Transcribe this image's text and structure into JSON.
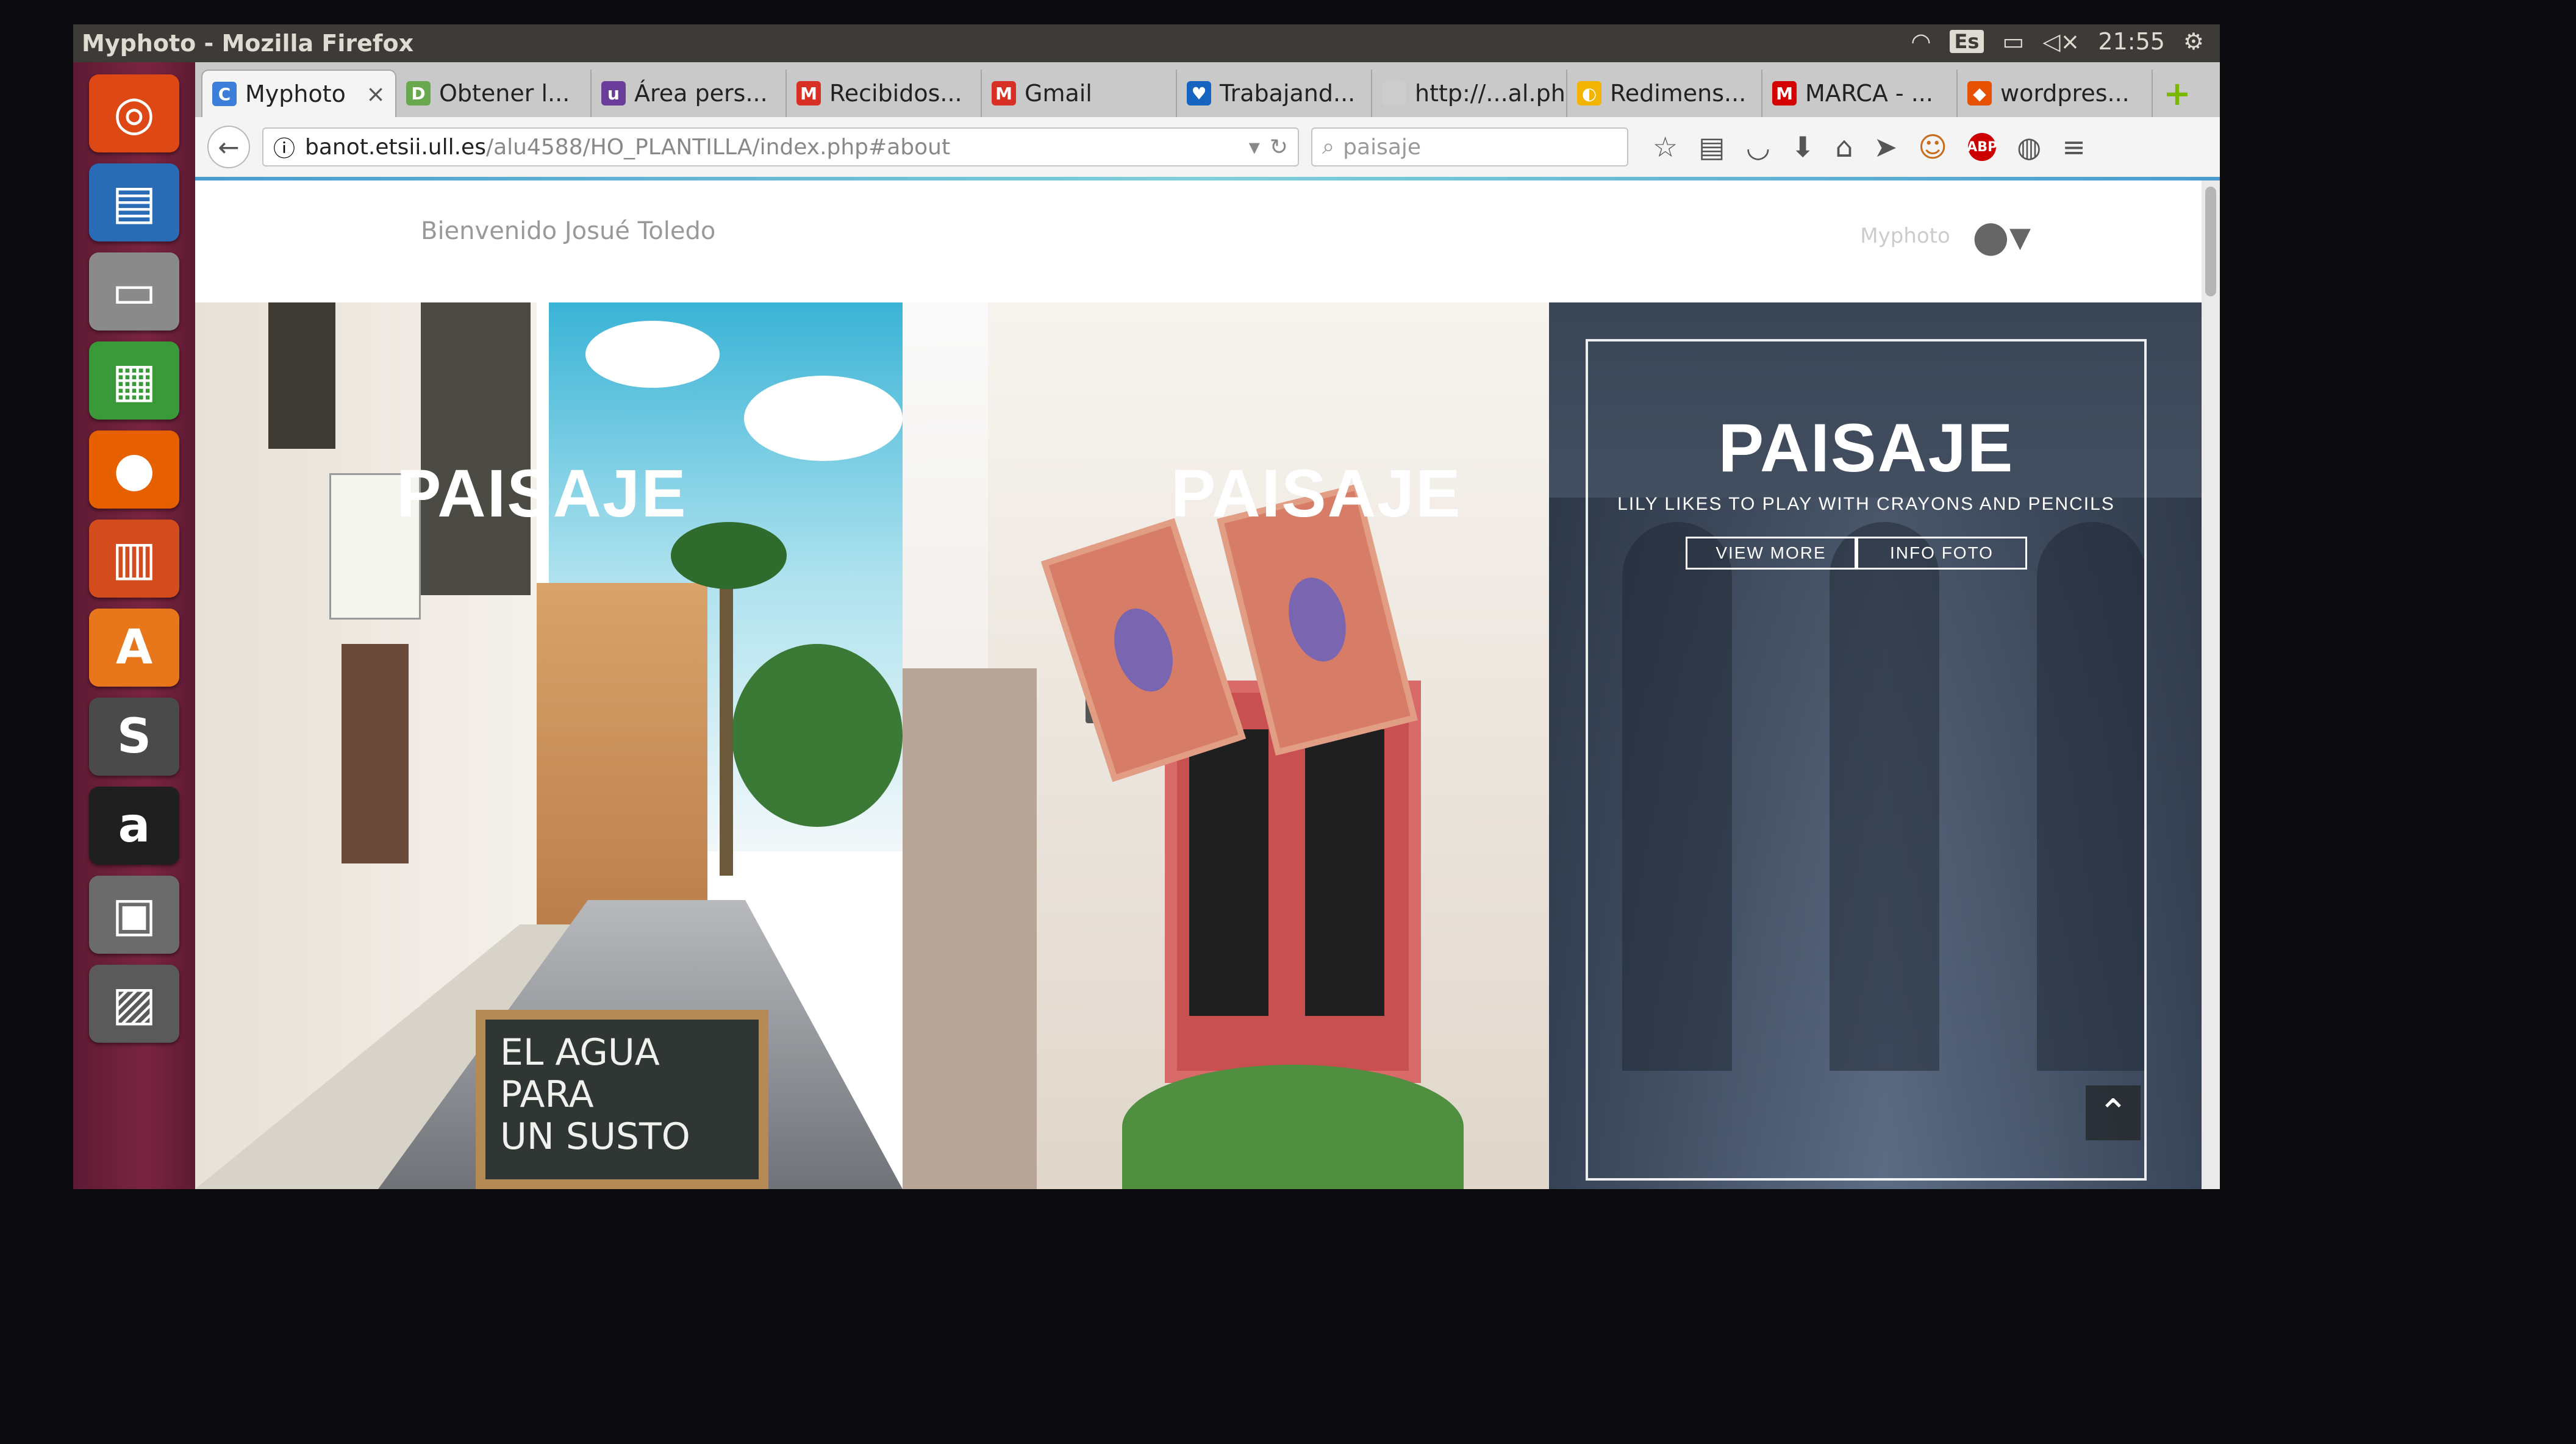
{
  "window": {
    "title": "Myphoto - Mozilla Firefox"
  },
  "panel": {
    "keyboard": "Es",
    "clock": "21:55"
  },
  "launcher": {
    "items": [
      {
        "name": "ubuntu-dash-icon",
        "glyph": "◎",
        "color": "#dd4814"
      },
      {
        "name": "writer-icon",
        "glyph": "▤",
        "color": "#2a6bb6"
      },
      {
        "name": "files-icon",
        "glyph": "▭",
        "color": "#8a8a8a"
      },
      {
        "name": "calc-icon",
        "glyph": "▦",
        "color": "#3a9a3a"
      },
      {
        "name": "firefox-icon",
        "glyph": "●",
        "color": "#e66000"
      },
      {
        "name": "impress-icon",
        "glyph": "▥",
        "color": "#d24c1e"
      },
      {
        "name": "software-center-icon",
        "glyph": "A",
        "color": "#e8771c"
      },
      {
        "name": "sublime-icon",
        "glyph": "S",
        "color": "#4a4a4a"
      },
      {
        "name": "amazon-icon",
        "glyph": "a",
        "color": "#1f1f1f"
      },
      {
        "name": "workspaces-icon",
        "glyph": "▣",
        "color": "#6b6b6b"
      },
      {
        "name": "trash-icon",
        "glyph": "▨",
        "color": "#5a5a5a"
      }
    ]
  },
  "tabs": [
    {
      "label": "Myphoto",
      "favicon": "C",
      "color": "#3b7dd8",
      "active": true
    },
    {
      "label": "Obtener l...",
      "favicon": "D",
      "color": "#6aa84f"
    },
    {
      "label": "Área pers...",
      "favicon": "u",
      "color": "#6a3d9a"
    },
    {
      "label": "Recibidos...",
      "favicon": "M",
      "color": "#d93025"
    },
    {
      "label": "Gmail",
      "favicon": "M",
      "color": "#d93025"
    },
    {
      "label": "Trabajand...",
      "favicon": "♥",
      "color": "#1565c0"
    },
    {
      "label": "http://...al.php",
      "favicon": "",
      "color": "#cccccc"
    },
    {
      "label": "Redimens...",
      "favicon": "◐",
      "color": "#f2b400"
    },
    {
      "label": "MARCA - ...",
      "favicon": "M",
      "color": "#d50000"
    },
    {
      "label": "wordpres...",
      "favicon": "◆",
      "color": "#e65100"
    }
  ],
  "nav": {
    "url_host": "banot.etsii.ull.es",
    "url_path": "/alu4588/HO_PLANTILLA/index.php#about",
    "search_placeholder": "paisaje"
  },
  "site": {
    "welcome": "Bienvenido Josué Toledo",
    "user_link": "Myphoto"
  },
  "gallery": {
    "panel1_title": "PAISAJE",
    "panel1_board": [
      "EL AGUA PARA",
      "UN SUSTO"
    ],
    "panel2_title": "PAISAJE",
    "panel3": {
      "title": "PAISAJE",
      "subtitle": "LILY LIKES TO PLAY WITH CRAYONS AND PENCILS",
      "view_more": "VIEW MORE",
      "info_foto": "INFO FOTO"
    }
  },
  "colors": {
    "launcher": "#7a2540",
    "accent_progress": "#4a9bd1",
    "panel_bg": "#3a4656"
  }
}
